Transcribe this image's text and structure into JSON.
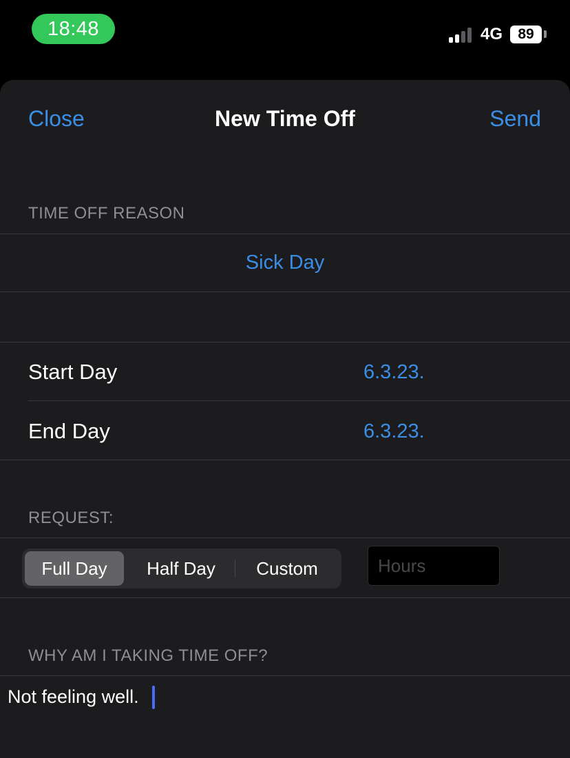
{
  "status_bar": {
    "time": "18:48",
    "network": "4G",
    "battery": "89"
  },
  "nav": {
    "close_label": "Close",
    "title": "New Time Off",
    "send_label": "Send"
  },
  "time_off_reason": {
    "header": "TIME OFF REASON",
    "value": "Sick Day"
  },
  "dates": {
    "start_label": "Start Day",
    "start_value": "6.3.23.",
    "end_label": "End Day",
    "end_value": "6.3.23."
  },
  "request": {
    "header": "REQUEST:",
    "options": [
      "Full Day",
      "Half Day",
      "Custom"
    ],
    "selected": "Full Day",
    "hours_placeholder": "Hours"
  },
  "why": {
    "header": "WHY AM I TAKING TIME OFF?",
    "text": "Not feeling well."
  },
  "colors": {
    "accent": "#3a8ee6",
    "background": "#1c1c1e",
    "status_pill": "#34c759"
  }
}
